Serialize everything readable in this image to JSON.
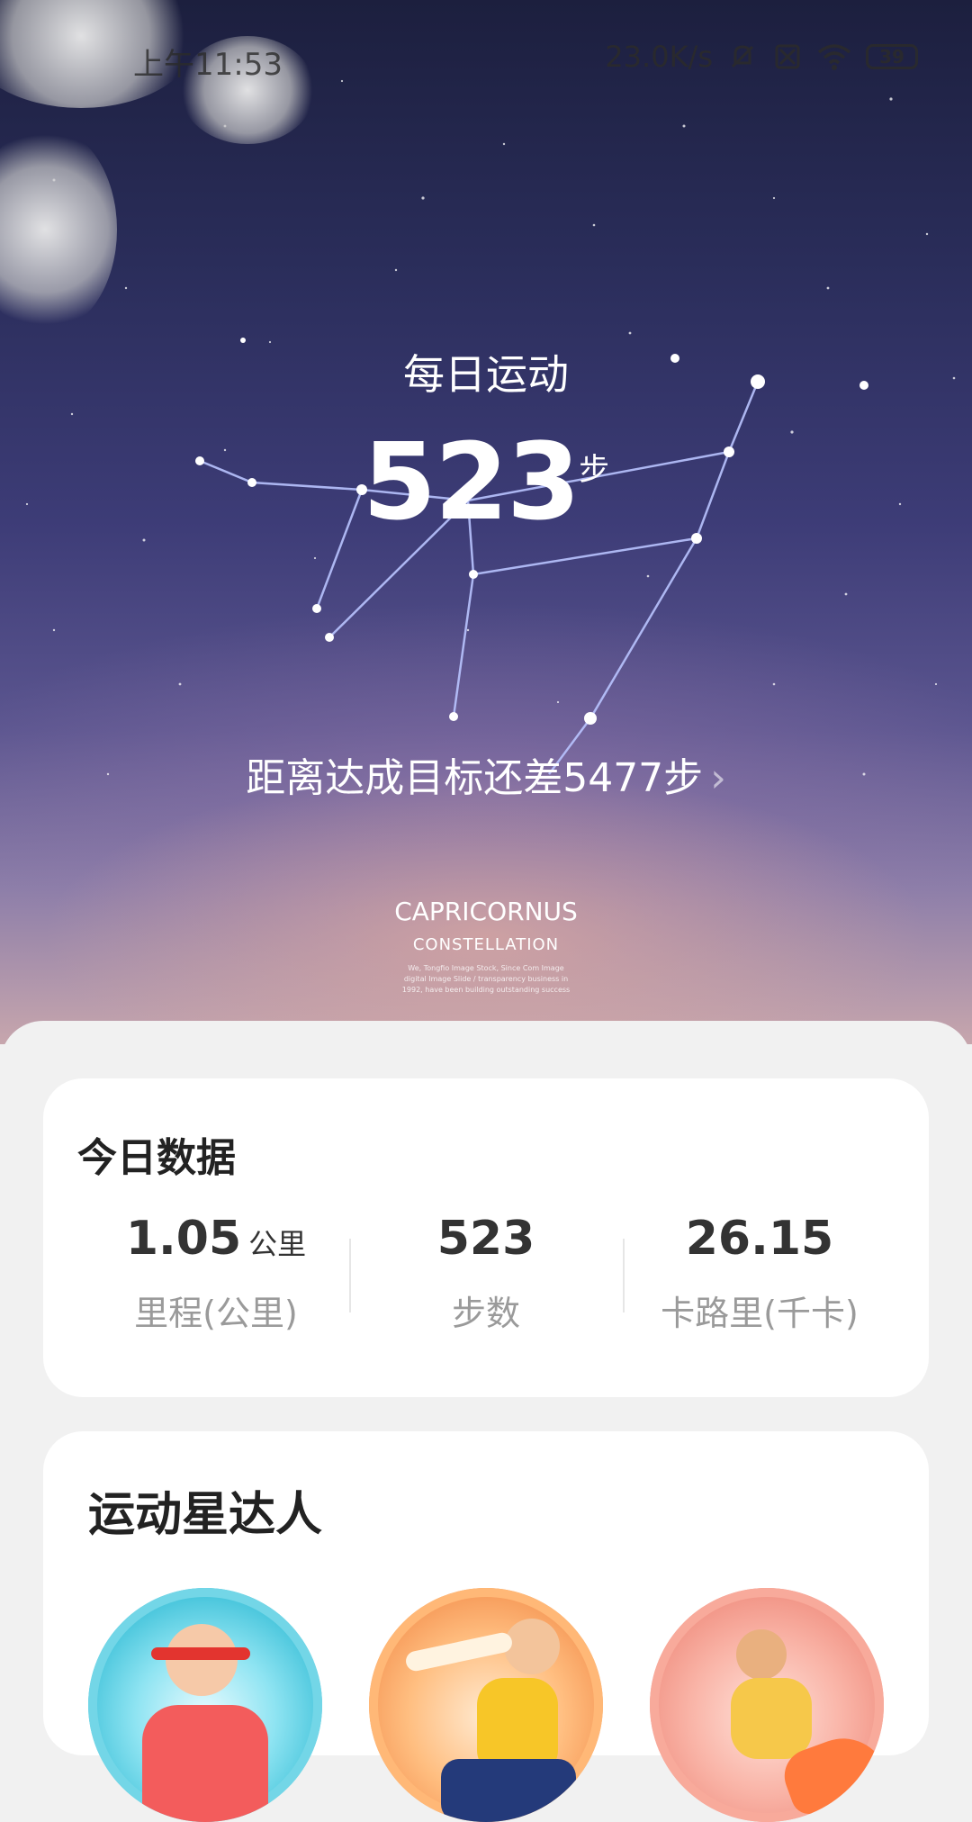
{
  "status_bar": {
    "time": "上午11:53",
    "net_speed": "23.0K/s",
    "battery": "39",
    "icons": [
      "mute-icon",
      "sim-off-icon",
      "wifi-icon",
      "battery-icon"
    ]
  },
  "hero": {
    "title": "每日运动",
    "steps_value": "523",
    "steps_unit": "步",
    "goal_text": "距离达成目标还差5477步",
    "goal_chevron": "›",
    "constellation_name": "CAPRICORNUS",
    "constellation_sub": "CONSTELLATION",
    "small_print_1": "We, Tongfio Image Stock, Since Com Image",
    "small_print_2": "digital Image Slide / transparency business in",
    "small_print_3": "1992, have been building outstanding success"
  },
  "today": {
    "title": "今日数据",
    "stats": [
      {
        "value": "1.05",
        "unit": "公里",
        "label": "里程(公里)"
      },
      {
        "value": "523",
        "unit": "",
        "label": "步数"
      },
      {
        "value": "26.15",
        "unit": "",
        "label": "卡路里(千卡)"
      }
    ]
  },
  "star_section": {
    "title": "运动星达人",
    "medals": [
      "medal-runner-blue",
      "medal-runner-orange",
      "medal-runner-pink"
    ]
  },
  "colors": {
    "sky_top": "#1c1f3e",
    "sky_bottom": "#c7a6ad",
    "card_bg": "#ffffff",
    "page_bg": "#f1f1f1"
  }
}
